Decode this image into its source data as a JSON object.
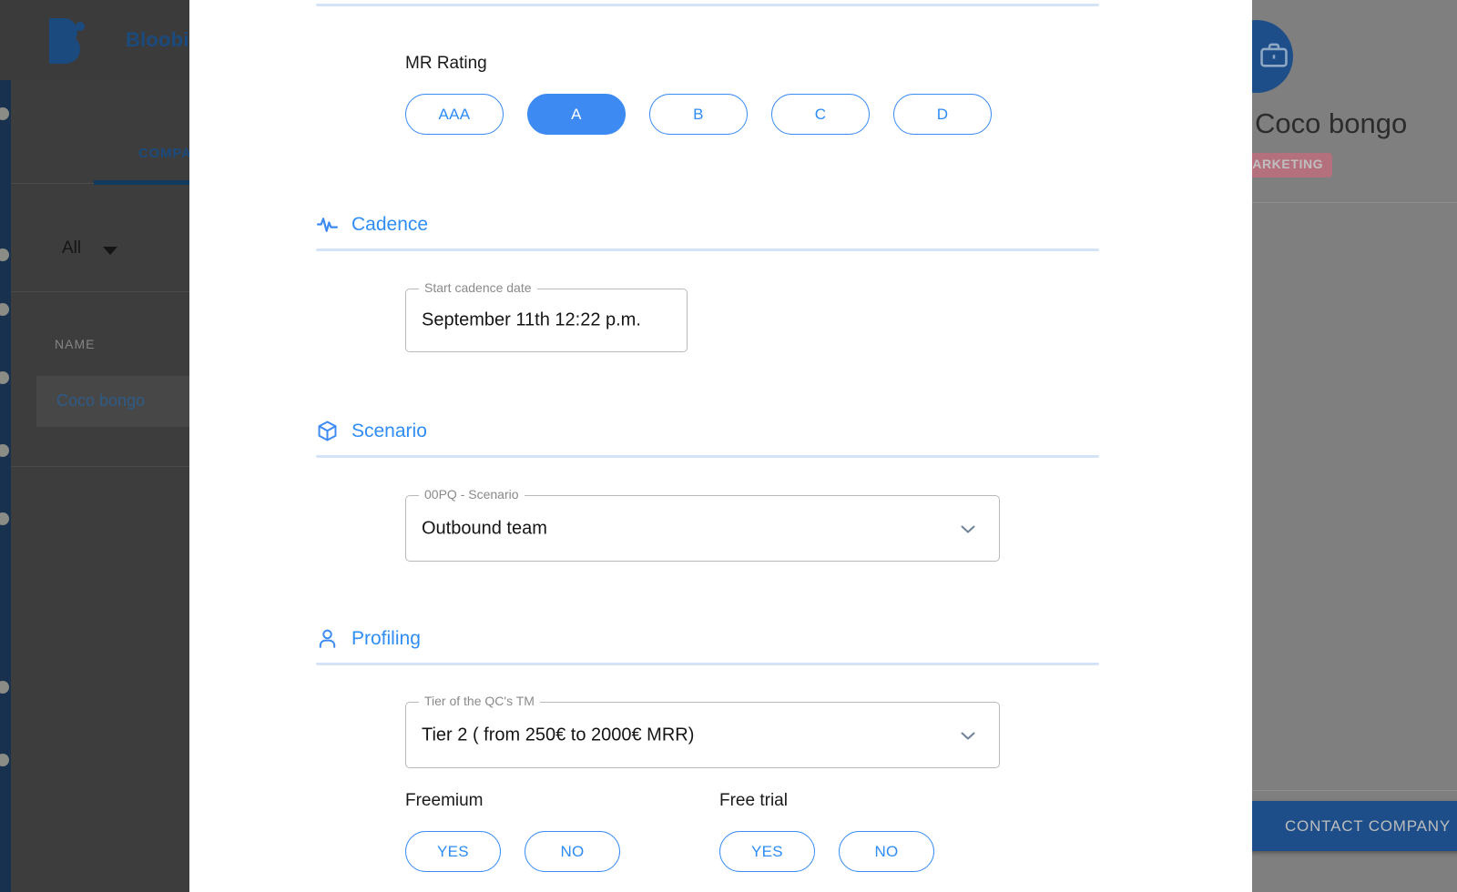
{
  "background": {
    "brand_name": "Bloobi",
    "logo_icon": "bloobi-b-logo",
    "tab_label": "COMPANIES",
    "filter_value": "All",
    "table_column_name": "NAME",
    "table_row_name": "Coco bongo",
    "detail": {
      "avatar_icon": "briefcase-icon",
      "company_name": "Coco bongo",
      "badge": "MARKETING",
      "contact_button": "CONTACT COMPANY"
    }
  },
  "modal": {
    "mr_rating": {
      "label": "MR Rating",
      "options": [
        "AAA",
        "A",
        "B",
        "C",
        "D"
      ],
      "selected": "A"
    },
    "cadence": {
      "icon": "activity-pulse-icon",
      "title": "Cadence",
      "start_date_label": "Start cadence date",
      "start_date_value": "September 11th 12:22 p.m."
    },
    "scenario": {
      "icon": "cube-box-icon",
      "title": "Scenario",
      "field_label": "00PQ - Scenario",
      "field_value": "Outbound team",
      "chevron_icon": "chevron-down-icon"
    },
    "profiling": {
      "icon": "user-person-icon",
      "title": "Profiling",
      "tier_label": "Tier of the QC's TM",
      "tier_value": "Tier 2 ( from 250€ to 2000€ MRR)",
      "chevron_icon": "chevron-down-icon",
      "freemium": {
        "label": "Freemium",
        "options": [
          "YES",
          "NO"
        ]
      },
      "free_trial": {
        "label": "Free trial",
        "options": [
          "YES",
          "NO"
        ]
      }
    }
  },
  "colors": {
    "accent_blue": "#3d8bf2",
    "section_title_blue": "#2f8df4",
    "rule_blue": "#d4e3f7",
    "brand_navy": "#1b4a7e",
    "badge_pink": "#b5707d"
  }
}
